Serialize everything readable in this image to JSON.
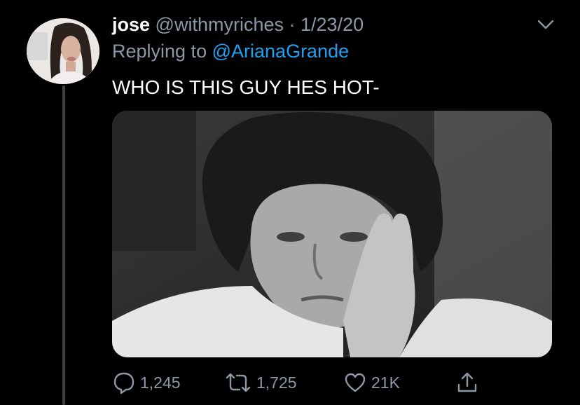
{
  "tweet": {
    "display_name": "jose",
    "handle": "@withmyriches",
    "separator": "·",
    "date": "1/23/20",
    "replying_to_prefix": "Replying to",
    "replying_to_handle": "@ArianaGrande",
    "text": "WHO IS THIS GUY HES HOT-"
  },
  "actions": {
    "replies": "1,245",
    "retweets": "1,725",
    "likes": "21K"
  },
  "icons": {
    "menu": "chevron-down-icon",
    "reply": "reply-bubble-icon",
    "retweet": "retweet-icon",
    "like": "heart-icon",
    "share": "share-upload-icon"
  },
  "colors": {
    "background": "#000000",
    "text": "#ffffff",
    "muted": "#8b98a5",
    "link": "#1da1f2",
    "thread_line": "#3d4147"
  }
}
